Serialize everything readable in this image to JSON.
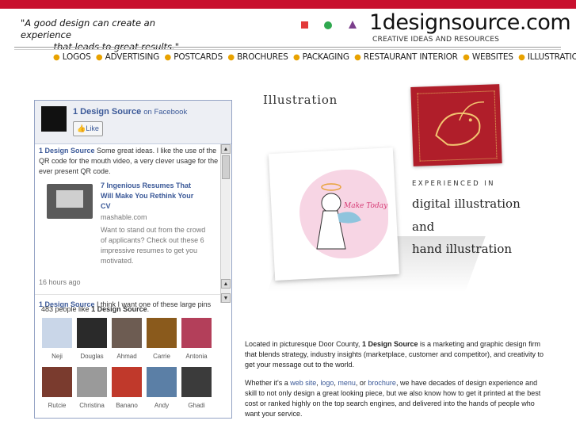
{
  "header": {
    "quote_line1": "\"A good design can create an experience",
    "quote_line2": "that leads to great results.\"",
    "logo": "1designsource.com",
    "tagline": "CREATIVE IDEAS AND RESOURCES"
  },
  "colors": {
    "topbar": "#c8102e",
    "nav_dot": "#e8a200",
    "square": "#e23a3a",
    "circle": "#2fa84f",
    "triangle": "#7b3f8c",
    "fb_link": "#3b5998"
  },
  "nav": {
    "items": [
      "LOGOS",
      "ADVERTISING",
      "POSTCARDS",
      "BROCHURES",
      "PACKAGING",
      "RESTAURANT INTERIOR",
      "WEBSITES",
      "ILLUSTRATION"
    ]
  },
  "facebook": {
    "page_name": "1 Design Source",
    "on_text": "on Facebook",
    "like_label": "Like",
    "post1_author": "1 Design Source",
    "post1_text": "Some great ideas. I like the use of the QR code for the mouth video, a very clever usage for the ever present QR code.",
    "attach_title": "7 Ingenious Resumes That Will Make You Rethink Your CV",
    "attach_source": "mashable.com",
    "attach_desc": "Want to stand out from the crowd of applicants? Check out these 6 impressive resumes to get you motivated.",
    "post1_time": "16 hours ago",
    "post2_author": "1 Design Source",
    "post2_text": "I think I want one of these large pins",
    "likes_count": "483 people like",
    "likes_page": "1 Design Source",
    "likes_period": ".",
    "faces": [
      {
        "name": "Neji",
        "color": "#c9d6e8"
      },
      {
        "name": "Douglas",
        "color": "#2a2a2a"
      },
      {
        "name": "Ahmad",
        "color": "#6d5c52"
      },
      {
        "name": "Carrie",
        "color": "#8a5a1c"
      },
      {
        "name": "Antonia",
        "color": "#b33f5a"
      },
      {
        "name": "Rutcie",
        "color": "#7a3b2e"
      },
      {
        "name": "Christina",
        "color": "#9a9a9a"
      },
      {
        "name": "Banano",
        "color": "#c0392b"
      },
      {
        "name": "Andy",
        "color": "#5b7fa6"
      },
      {
        "name": "Ghadi",
        "color": "#3b3b3b"
      }
    ]
  },
  "illustration": {
    "title": "Illustration",
    "card_text": "Make Today Done",
    "experienced": "EXPERIENCED IN",
    "service1": "digital illustration",
    "service2": "and",
    "service3": "hand illustration"
  },
  "about": {
    "p1_a": "Located in picturesque Door County,",
    "p1_b": "1 Design Source",
    "p1_c": "is a marketing and graphic design firm that blends strategy, industry insights (marketplace, customer and competitor), and creativity to get your message out to the world.",
    "p2_a": "Whether it's a",
    "p2_web": "web site",
    "p2_logo": "logo",
    "p2_menu": "menu",
    "p2_or": "or",
    "p2_brochure": "brochure",
    "p2_b": "we have decades of design experience and skill to not only design a great looking piece, but we also know how to get it printed at the best cost or ranked highly on the top search engines, and delivered into the hands of people who want your service."
  }
}
